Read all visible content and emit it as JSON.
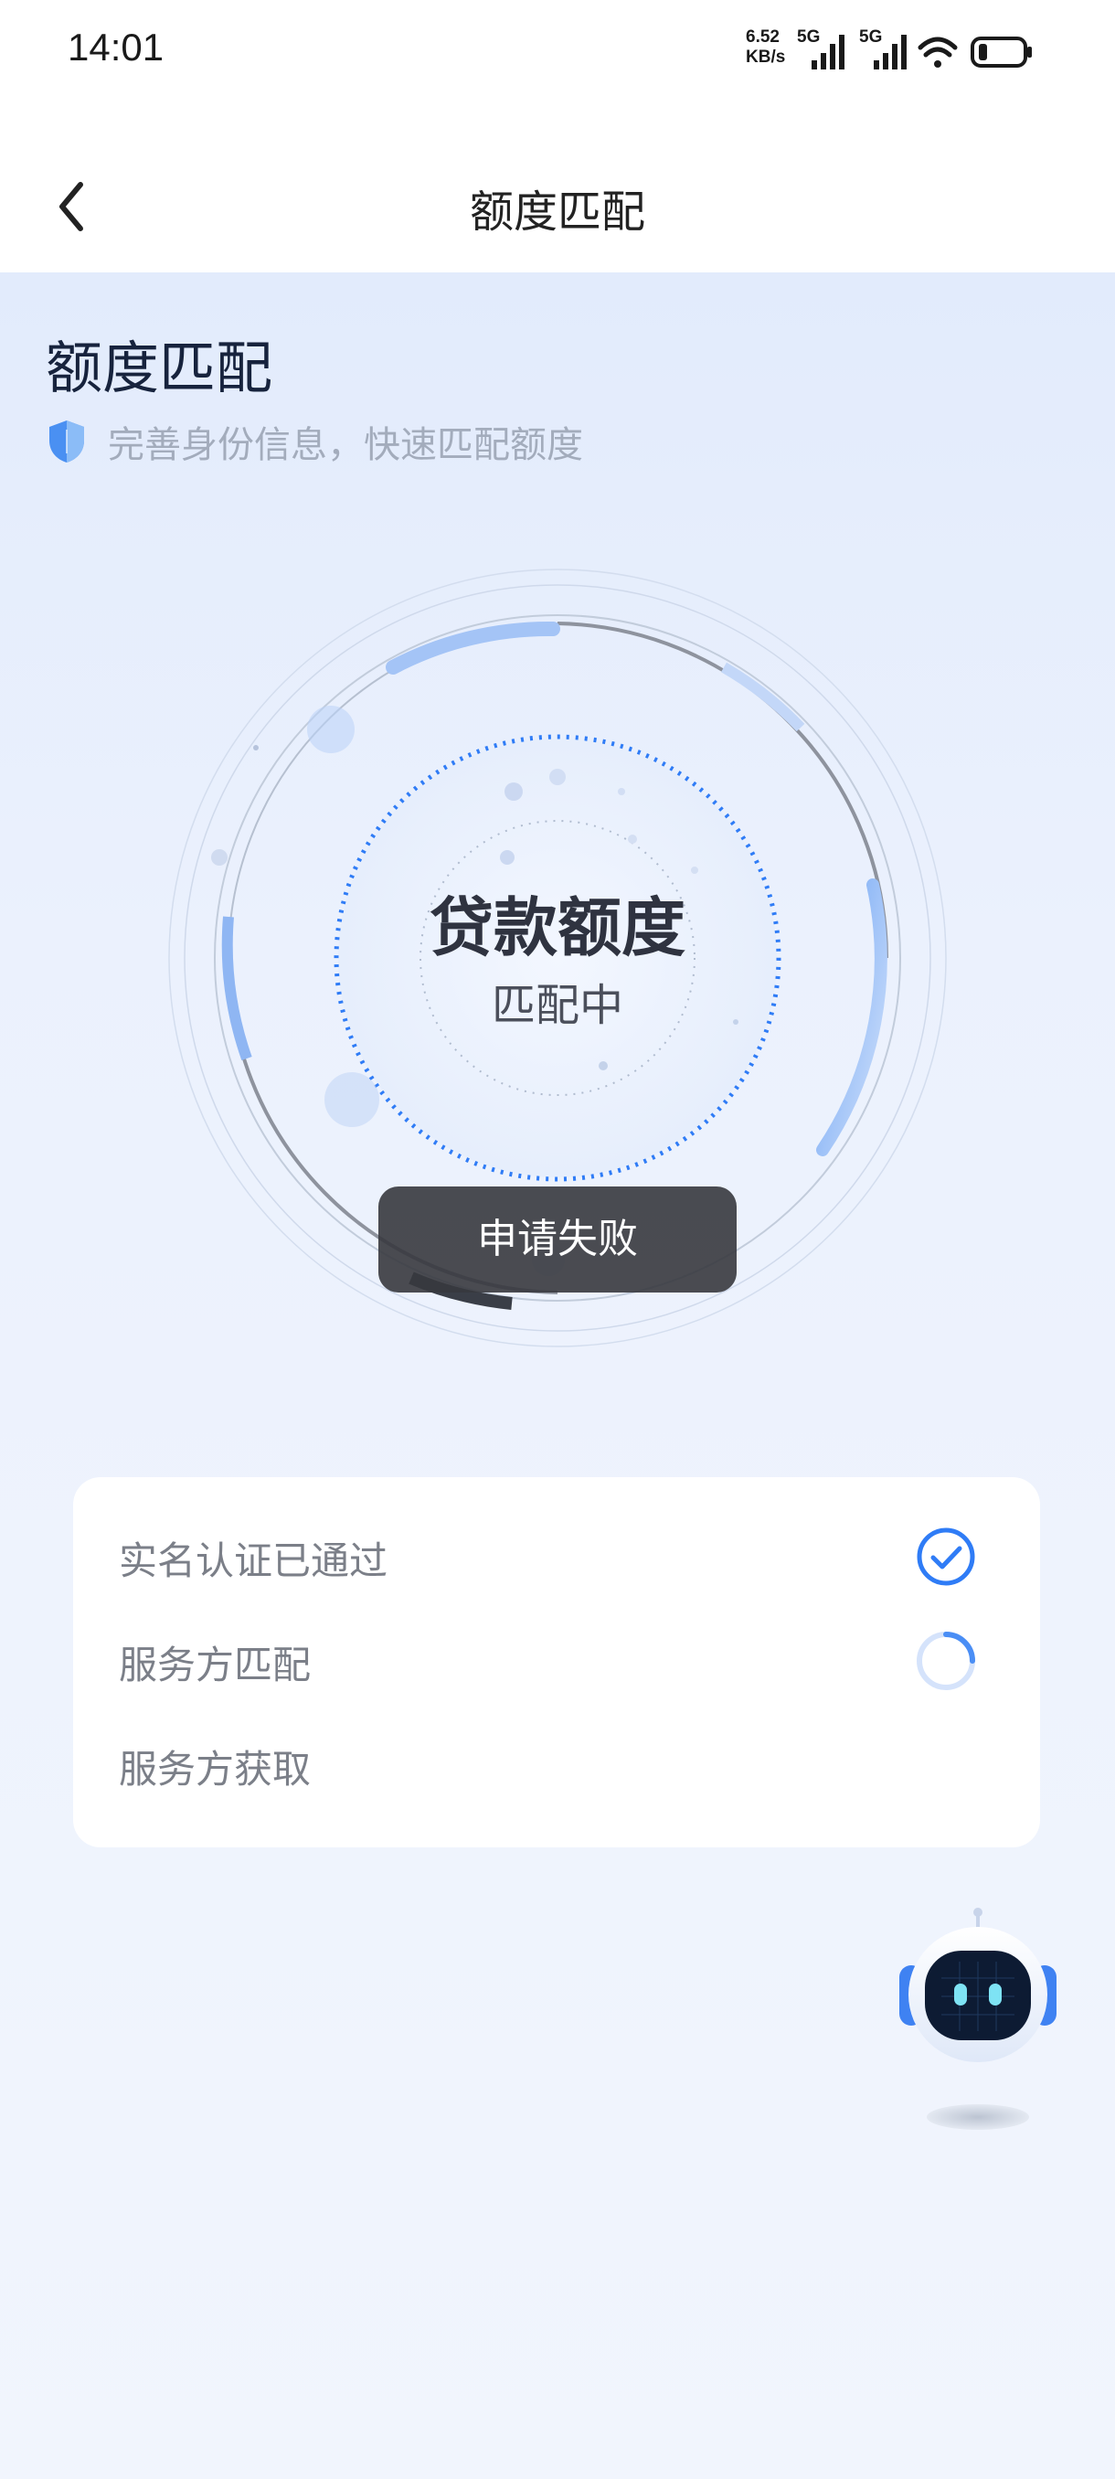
{
  "status_bar": {
    "time": "14:01",
    "net_speed_value": "6.52",
    "net_speed_unit": "KB/s",
    "network_1": "5G",
    "network_2": "5G",
    "icons": [
      "signal-icon",
      "signal-icon",
      "wifi-icon",
      "battery-icon"
    ]
  },
  "nav": {
    "title": "额度匹配",
    "back_icon": "chevron-left-icon"
  },
  "header": {
    "title": "额度匹配",
    "subtitle": "完善身份信息，快速匹配额度",
    "subtitle_icon": "shield-icon"
  },
  "matcher": {
    "title": "贷款额度",
    "status": "匹配中"
  },
  "toast": {
    "message": "申请失败"
  },
  "steps": [
    {
      "label": "实名认证已通过",
      "state": "done",
      "icon": "check-circle-icon"
    },
    {
      "label": "服务方匹配",
      "state": "loading",
      "icon": "spinner-icon"
    },
    {
      "label": "服务方获取",
      "state": "pending"
    }
  ],
  "assistant": {
    "icon": "robot-assistant-icon"
  },
  "colors": {
    "accent": "#2f7cf6",
    "background_top": "#e2ebfc",
    "toast_bg": "#37393e"
  }
}
